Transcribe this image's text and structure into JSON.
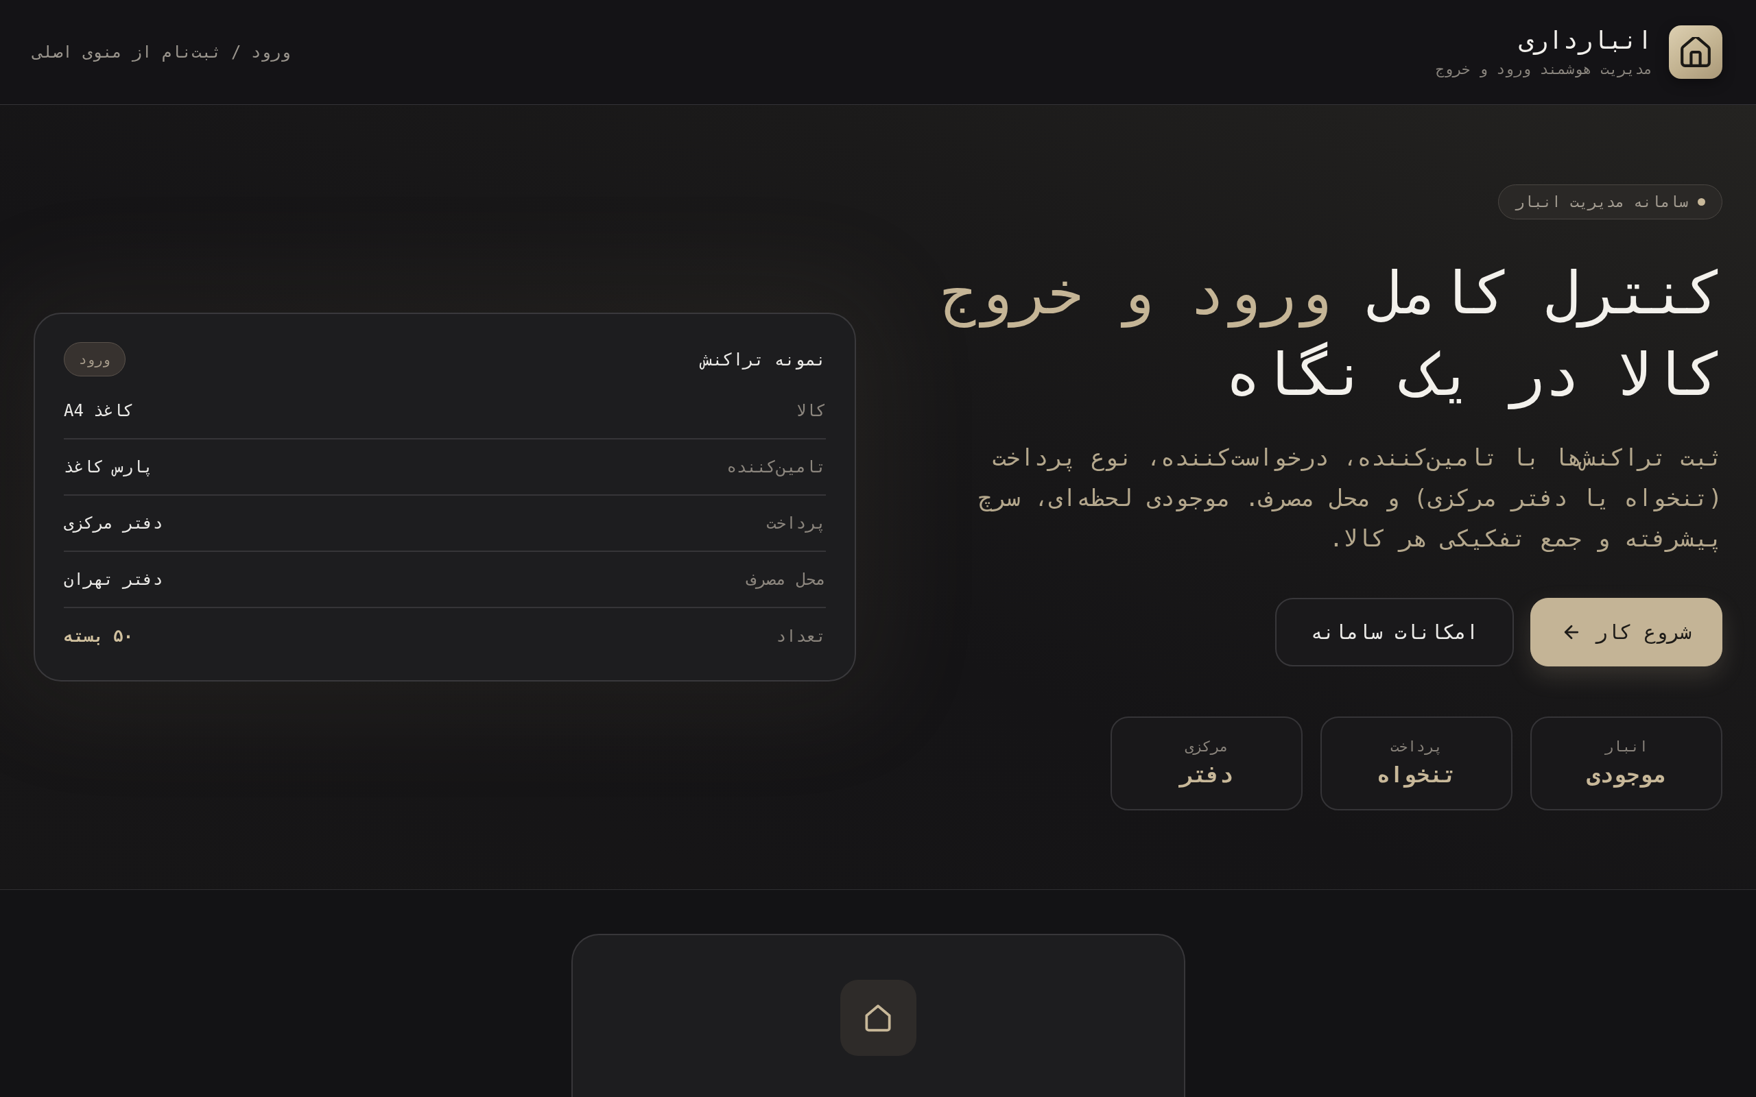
{
  "header": {
    "brand": {
      "title": "انبارداری",
      "subtitle": "مدیریت هوشمند ورود و خروج"
    },
    "auth_hint": "ورود / ثبت‌نام از منوی اصلی"
  },
  "hero": {
    "tag": "سامانه مدیریت انبار",
    "headline": [
      {
        "text": "کنترل کامل",
        "highlight": false
      },
      {
        "text": "ورود و خروج",
        "highlight": true
      },
      {
        "text": "کالا در یک نگاه",
        "highlight": false
      }
    ],
    "description": "ثبت تراکنش‌ها با تامین‌کننده، درخواست‌کننده، نوع پرداخت (تنخواه یا دفتر مرکزی) و محل مصرف. موجودی لحظه‌ای، سرچ پیشرفته و جمع تفکیکی هر کالا.",
    "buttons": [
      {
        "label": "شروع کار",
        "kind": "primary"
      },
      {
        "label": "امکانات سامانه",
        "kind": "secondary"
      }
    ],
    "stats": [
      {
        "label": "انبار",
        "value": "موجودی"
      },
      {
        "label": "پرداخت",
        "value": "تنخواه"
      },
      {
        "label": "مرکزی",
        "value": "دفتر"
      }
    ]
  },
  "sample_transaction": {
    "title": "نمونه تراکنش",
    "type": "ورود",
    "fields": [
      {
        "label": "کالا",
        "value": "کاغذ A4",
        "emphasis": false
      },
      {
        "label": "تامین‌کننده",
        "value": "پارس کاغذ",
        "emphasis": false
      },
      {
        "label": "پرداخت",
        "value": "دفتر مرکزی",
        "emphasis": false
      },
      {
        "label": "محل مصرف",
        "value": "دفتر تهران",
        "emphasis": false
      },
      {
        "label": "تعداد",
        "value": "۵۰ بسته",
        "emphasis": true
      }
    ]
  }
}
